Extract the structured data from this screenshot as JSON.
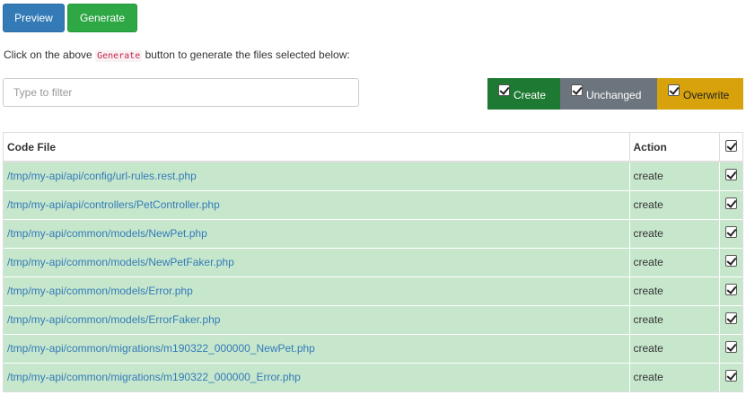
{
  "toolbar": {
    "preview_label": "Preview",
    "generate_label": "Generate"
  },
  "instruction": {
    "before": "Click on the above ",
    "code": "Generate",
    "after": " button to generate the files selected below:"
  },
  "filter": {
    "placeholder": "Type to filter",
    "value": ""
  },
  "legend": {
    "create": "Create",
    "unchanged": "Unchanged",
    "overwrite": "Overwrite"
  },
  "table": {
    "headers": {
      "file": "Code File",
      "action": "Action"
    },
    "rows": [
      {
        "file": "/tmp/my-api/api/config/url-rules.rest.php",
        "action": "create",
        "checked": true
      },
      {
        "file": "/tmp/my-api/api/controllers/PetController.php",
        "action": "create",
        "checked": true
      },
      {
        "file": "/tmp/my-api/common/models/NewPet.php",
        "action": "create",
        "checked": true
      },
      {
        "file": "/tmp/my-api/common/models/NewPetFaker.php",
        "action": "create",
        "checked": true
      },
      {
        "file": "/tmp/my-api/common/models/Error.php",
        "action": "create",
        "checked": true
      },
      {
        "file": "/tmp/my-api/common/models/ErrorFaker.php",
        "action": "create",
        "checked": true
      },
      {
        "file": "/tmp/my-api/common/migrations/m190322_000000_NewPet.php",
        "action": "create",
        "checked": true
      },
      {
        "file": "/tmp/my-api/common/migrations/m190322_000000_Error.php",
        "action": "create",
        "checked": true
      }
    ]
  },
  "colors": {
    "preview": "#337ab7",
    "generate": "#2ea745",
    "create": "#1e7a32",
    "unchanged": "#6c757d",
    "overwrite": "#d7a20b",
    "row_create": "#c7e7cd",
    "link": "#337ab7"
  }
}
